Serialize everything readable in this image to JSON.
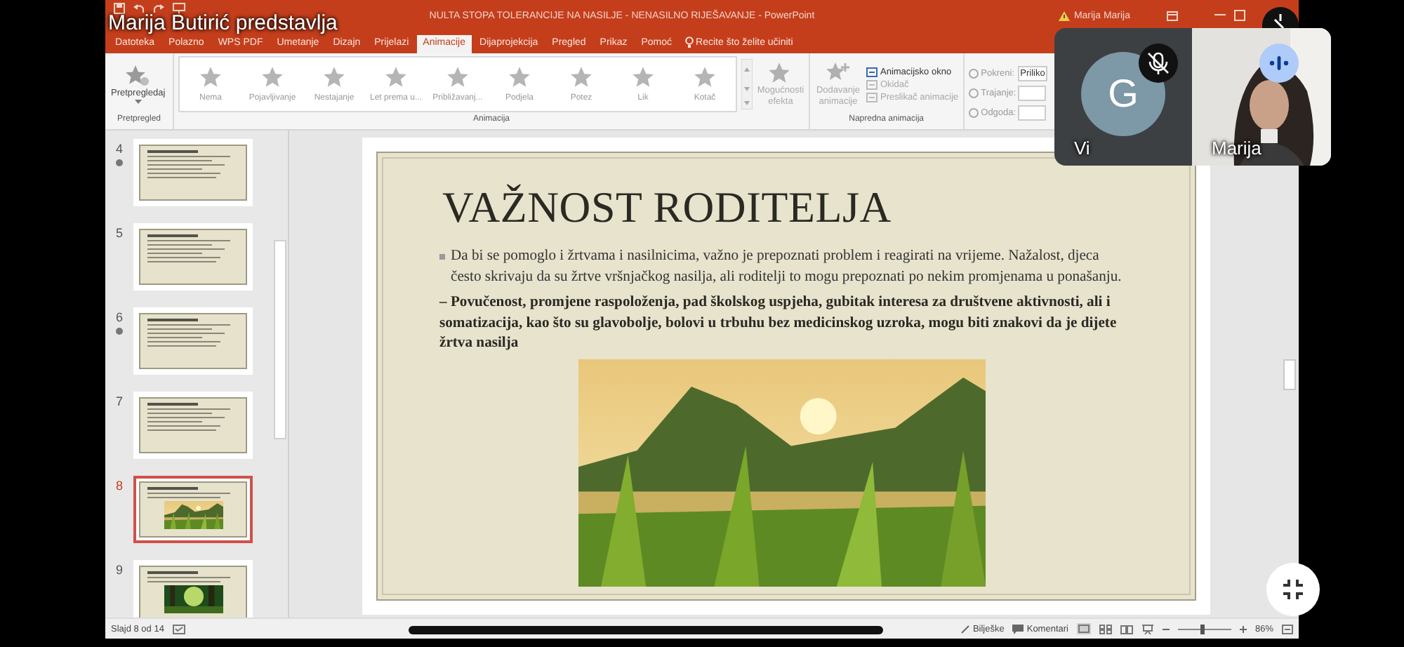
{
  "presenter_label": "Marija Butirić predstavlja",
  "window": {
    "title": "NULTA STOPA TOLERANCIJE NA NASILJE - NENASILNO RIJEŠAVANJE - PowerPoint",
    "user": "Marija Marija"
  },
  "tabs": [
    {
      "label": "Datoteka",
      "selected": false
    },
    {
      "label": "Polazno",
      "selected": false
    },
    {
      "label": "WPS PDF",
      "selected": false
    },
    {
      "label": "Umetanje",
      "selected": false
    },
    {
      "label": "Dizajn",
      "selected": false
    },
    {
      "label": "Prijelazi",
      "selected": false
    },
    {
      "label": "Animacije",
      "selected": true
    },
    {
      "label": "Dijaprojekcija",
      "selected": false
    },
    {
      "label": "Pregled",
      "selected": false
    },
    {
      "label": "Prikaz",
      "selected": false
    },
    {
      "label": "Pomoć",
      "selected": false
    }
  ],
  "tell_me": "Recite što želite učiniti",
  "ribbon": {
    "preview": {
      "label": "Pretpregledaj",
      "group": "Pretpregled"
    },
    "animation": {
      "items": [
        "Nema",
        "Pojavljivanje",
        "Nestajanje",
        "Let prema u...",
        "Približavanj...",
        "Podjela",
        "Potez",
        "Lik",
        "Kotač"
      ],
      "effect_options": "Mogućnosti efekta",
      "group": "Animacija"
    },
    "advanced": {
      "add_animation": "Dodavanje animacije",
      "group": "Napredna animacija",
      "items": [
        {
          "label": "Animacijsko okno",
          "disabled": false
        },
        {
          "label": "Okidač",
          "disabled": true
        },
        {
          "label": "Preslikač animacije",
          "disabled": true
        }
      ]
    },
    "timing": [
      {
        "label": "Pokreni:",
        "value": "Priliko"
      },
      {
        "label": "Trajanje:"
      },
      {
        "label": "Odgoda:"
      }
    ]
  },
  "thumbnails": [
    {
      "number": "4",
      "selected": false,
      "animated": true,
      "kind": "text"
    },
    {
      "number": "5",
      "selected": false,
      "animated": false,
      "kind": "text"
    },
    {
      "number": "6",
      "selected": false,
      "animated": true,
      "kind": "text"
    },
    {
      "number": "7",
      "selected": false,
      "animated": false,
      "kind": "text"
    },
    {
      "number": "8",
      "selected": true,
      "animated": false,
      "kind": "picture"
    },
    {
      "number": "9",
      "selected": false,
      "animated": false,
      "kind": "picture"
    }
  ],
  "slide": {
    "title": "VAŽNOST RODITELJA",
    "bullet": "Da bi se pomoglo i žrtvama i nasilnicima, važno je prepoznati problem i reagirati na vrijeme. Nažalost, djeca često skrivaju da su žrtve vršnjačkog nasilja, ali roditelji to mogu prepoznati po nekim promjenama u ponašanju.",
    "paragraph": "– Povučenost, promjene raspoloženja, pad školskog uspjeha, gubitak interesa za društvene aktivnosti, ali i somatizacija, kao što su glavobolje, bolovi u trbuhu bez medicinskog uzroka, mogu biti znakovi da je dijete žrtva nasilja"
  },
  "status_bar": {
    "slide_info": "Slajd 8 od 14",
    "notes": "Bilješke",
    "comments": "Komentari",
    "zoom": {
      "level": 0.45,
      "reading": "86%"
    }
  },
  "participants": [
    {
      "name": "Vi",
      "kind": "avatar",
      "initial": "G",
      "muted": true
    },
    {
      "name": "Marija",
      "kind": "video",
      "speaking": true
    }
  ]
}
